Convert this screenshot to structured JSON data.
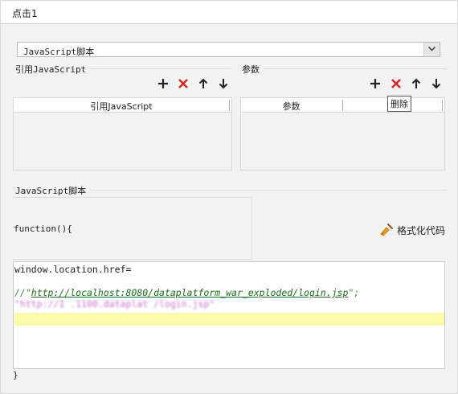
{
  "window": {
    "title": "点击1"
  },
  "script_type": {
    "selected": "JavaScript脚本"
  },
  "left_panel": {
    "title": "引用JavaScript",
    "columns": [
      "引用JavaScript"
    ],
    "toolbar": {
      "add": "add-icon",
      "delete": "delete-icon",
      "up": "arrow-up-icon",
      "down": "arrow-down-icon"
    }
  },
  "right_panel": {
    "title": "参数",
    "columns": [
      "参数",
      ""
    ],
    "tooltip": "删除"
  },
  "script_section": {
    "title": "JavaScript脚本",
    "header_line": "function(){",
    "format_button": "格式化代码",
    "closing_line": "}"
  },
  "editor": {
    "line1": "window.location.href=",
    "line2_prefix": "//\"",
    "line2_url": "http://localhost:8080/dataplatform_war_exploded/login.jsp",
    "line2_suffix": "\";",
    "line3_obscured": "\"http://1              .1100.dataplat     /login.jsp\""
  },
  "colors": {
    "delete_icon": "#e02020",
    "comment": "#3a8f3a",
    "highlight": "#fafaa8",
    "string": "#9a2aa0"
  }
}
